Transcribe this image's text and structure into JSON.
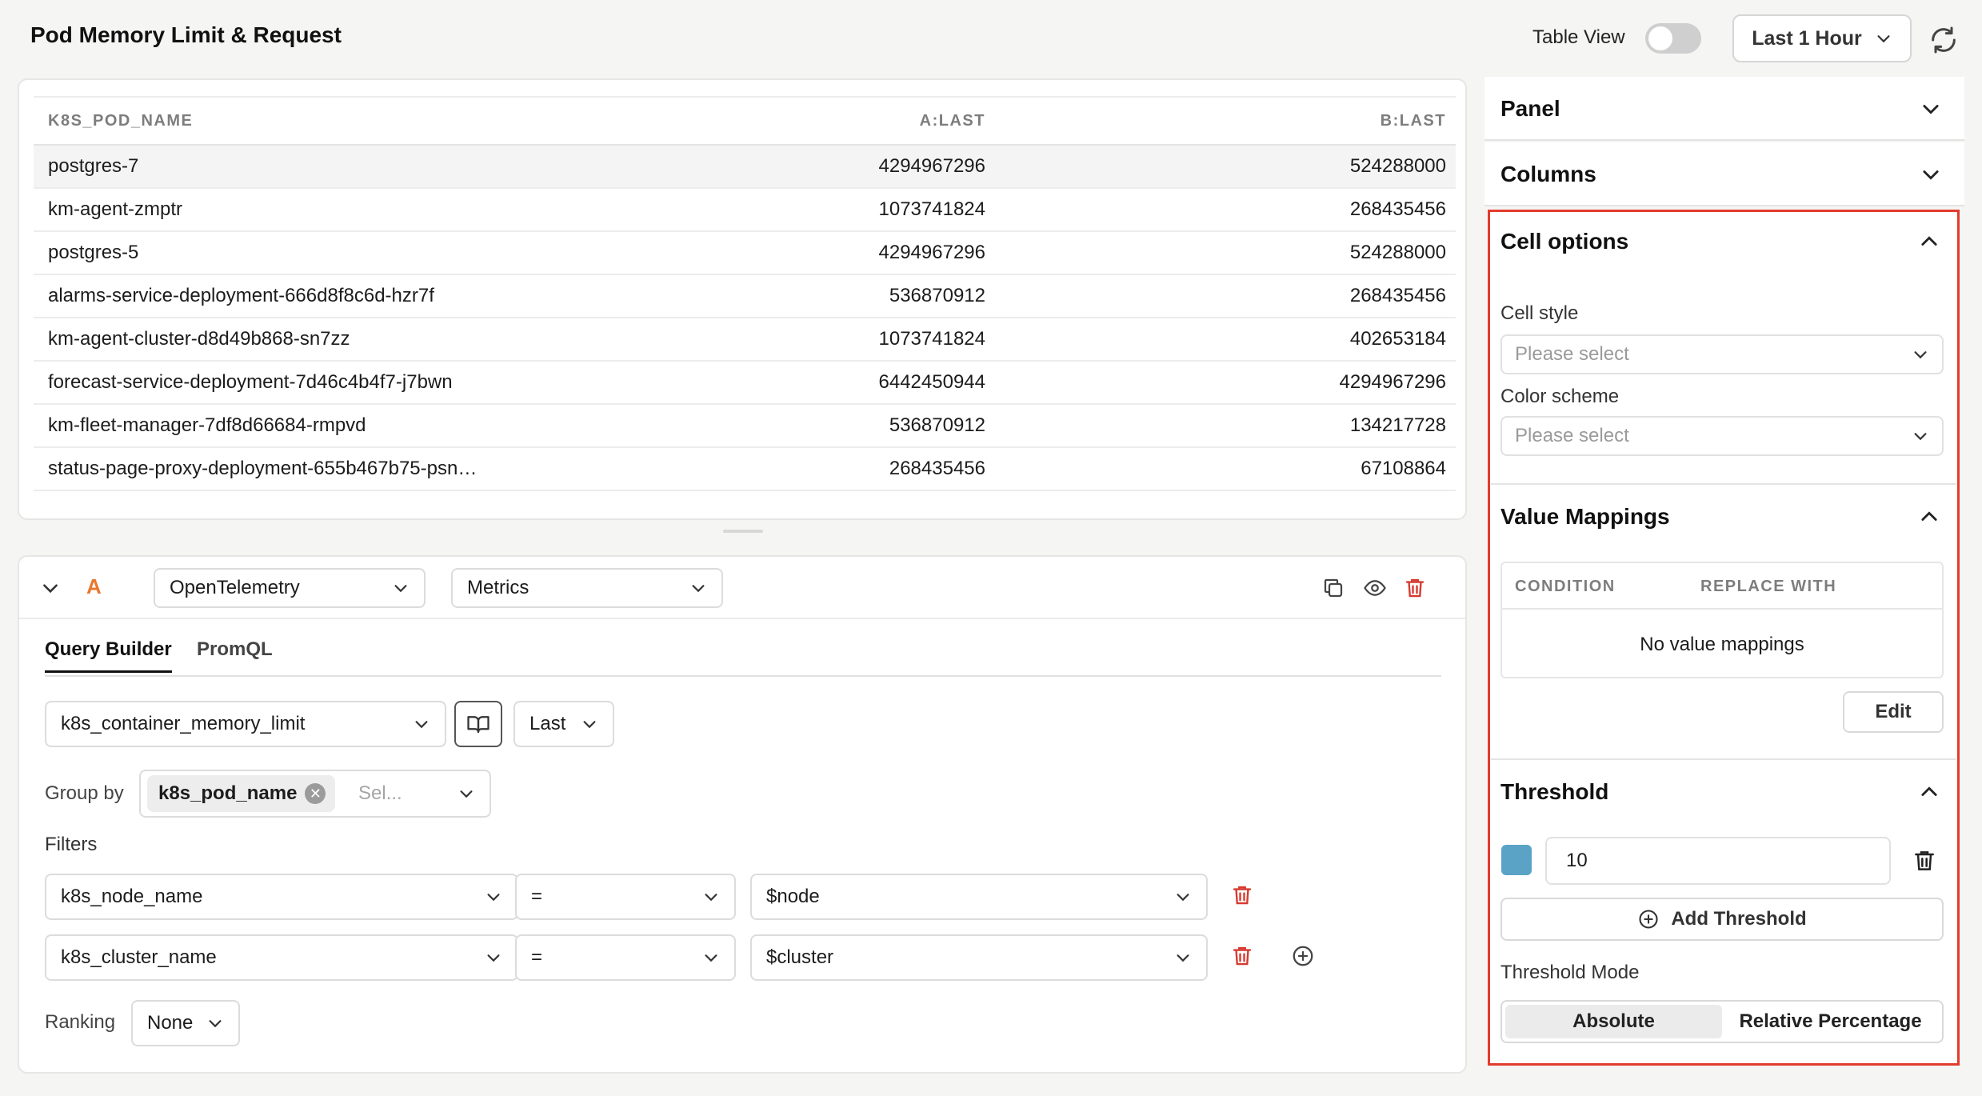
{
  "header": {
    "title": "Pod Memory Limit & Request",
    "table_view_label": "Table View",
    "table_view_on": false,
    "time_range": "Last 1 Hour"
  },
  "results": {
    "columns": [
      "K8S_POD_NAME",
      "A:LAST",
      "B:LAST"
    ],
    "rows": [
      [
        "postgres-7",
        "4294967296",
        "524288000"
      ],
      [
        "km-agent-zmptr",
        "1073741824",
        "268435456"
      ],
      [
        "postgres-5",
        "4294967296",
        "524288000"
      ],
      [
        "alarms-service-deployment-666d8f8c6d-hzr7f",
        "536870912",
        "268435456"
      ],
      [
        "km-agent-cluster-d8d49b868-sn7zz",
        "1073741824",
        "402653184"
      ],
      [
        "forecast-service-deployment-7d46c4b4f7-j7bwn",
        "6442450944",
        "4294967296"
      ],
      [
        "km-fleet-manager-7df8d66684-rmpvd",
        "536870912",
        "134217728"
      ],
      [
        "status-page-proxy-deployment-655b467b75-psn…",
        "268435456",
        "67108864"
      ]
    ]
  },
  "query": {
    "letter": "A",
    "datasource": "OpenTelemetry",
    "signal": "Metrics",
    "tabs": [
      "Query Builder",
      "PromQL"
    ],
    "metric": "k8s_container_memory_limit",
    "aggregation": "Last",
    "group_by_label": "Group by",
    "group_by_chip": "k8s_pod_name",
    "group_by_placeholder": "Sel...",
    "filters_label": "Filters",
    "filters": [
      {
        "key": "k8s_node_name",
        "op": "=",
        "value": "$node"
      },
      {
        "key": "k8s_cluster_name",
        "op": "=",
        "value": "$cluster"
      }
    ],
    "ranking_label": "Ranking",
    "ranking_value": "None"
  },
  "panel": {
    "sections": {
      "panel": "Panel",
      "columns": "Columns",
      "cell_options": "Cell options",
      "value_mappings": "Value Mappings",
      "threshold": "Threshold"
    },
    "cell_style_label": "Cell style",
    "cell_style_placeholder": "Please select",
    "color_scheme_label": "Color scheme",
    "color_scheme_placeholder": "Please select",
    "vm_columns": [
      "CONDITION",
      "REPLACE WITH"
    ],
    "vm_empty": "No value mappings",
    "edit_label": "Edit",
    "threshold_color": "#5aa3c7",
    "threshold_value": "10",
    "add_threshold_label": "Add Threshold",
    "threshold_mode_label": "Threshold Mode",
    "threshold_modes": [
      "Absolute",
      "Relative Percentage"
    ],
    "threshold_mode_selected": "Absolute"
  },
  "colors": {
    "accent_letter": "#e8772e",
    "delete_red": "#d63a2f",
    "highlight_border": "#e33b2c"
  }
}
